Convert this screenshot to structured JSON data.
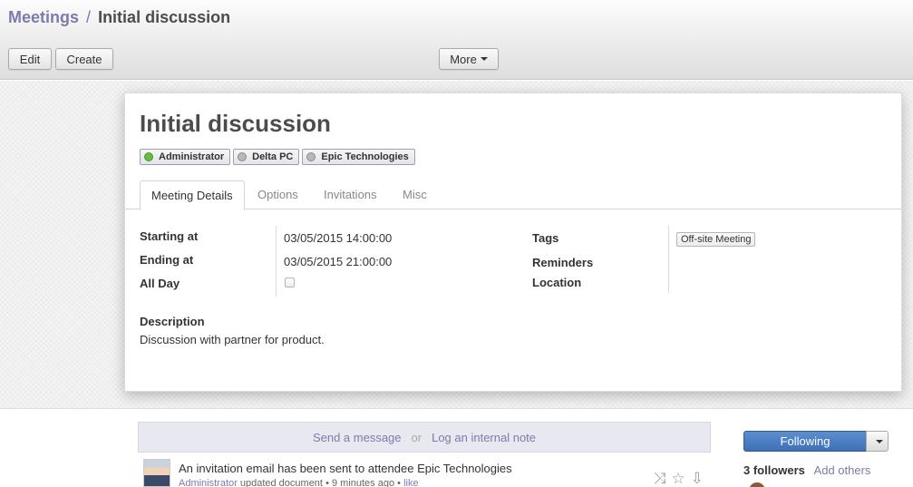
{
  "breadcrumb": {
    "parent": "Meetings",
    "separator": "/",
    "current": "Initial discussion"
  },
  "toolbar": {
    "edit_label": "Edit",
    "create_label": "Create",
    "more_label": "More"
  },
  "record": {
    "title": "Initial discussion",
    "attendees": [
      {
        "name": "Administrator",
        "status_color": "#66bb44"
      },
      {
        "name": "Delta PC",
        "status_color": "#b8b8b8"
      },
      {
        "name": "Epic Technologies",
        "status_color": "#b8b8b8"
      }
    ]
  },
  "tabs": [
    "Meeting Details",
    "Options",
    "Invitations",
    "Misc"
  ],
  "details": {
    "starting_label": "Starting at",
    "starting_value": "03/05/2015 14:00:00",
    "ending_label": "Ending at",
    "ending_value": "03/05/2015 21:00:00",
    "allday_label": "All Day",
    "allday_checked": false,
    "tags_label": "Tags",
    "tag_value": "Off-site Meeting",
    "reminders_label": "Reminders",
    "location_label": "Location",
    "description_label": "Description",
    "description_value": "Discussion with partner for product."
  },
  "chatter": {
    "send_message": "Send a message",
    "or": "or",
    "log_note": "Log an internal note",
    "message": {
      "text": "An invitation email has been sent to attendee Epic Technologies",
      "author": "Administrator",
      "action": "updated document",
      "sep": "•",
      "time": "9 minutes ago",
      "like": "like"
    },
    "following_label": "Following",
    "followers_count": "3 followers",
    "add_others": "Add others"
  },
  "colors": {
    "link": "#7c7bad",
    "primary": "#3f70b6"
  }
}
